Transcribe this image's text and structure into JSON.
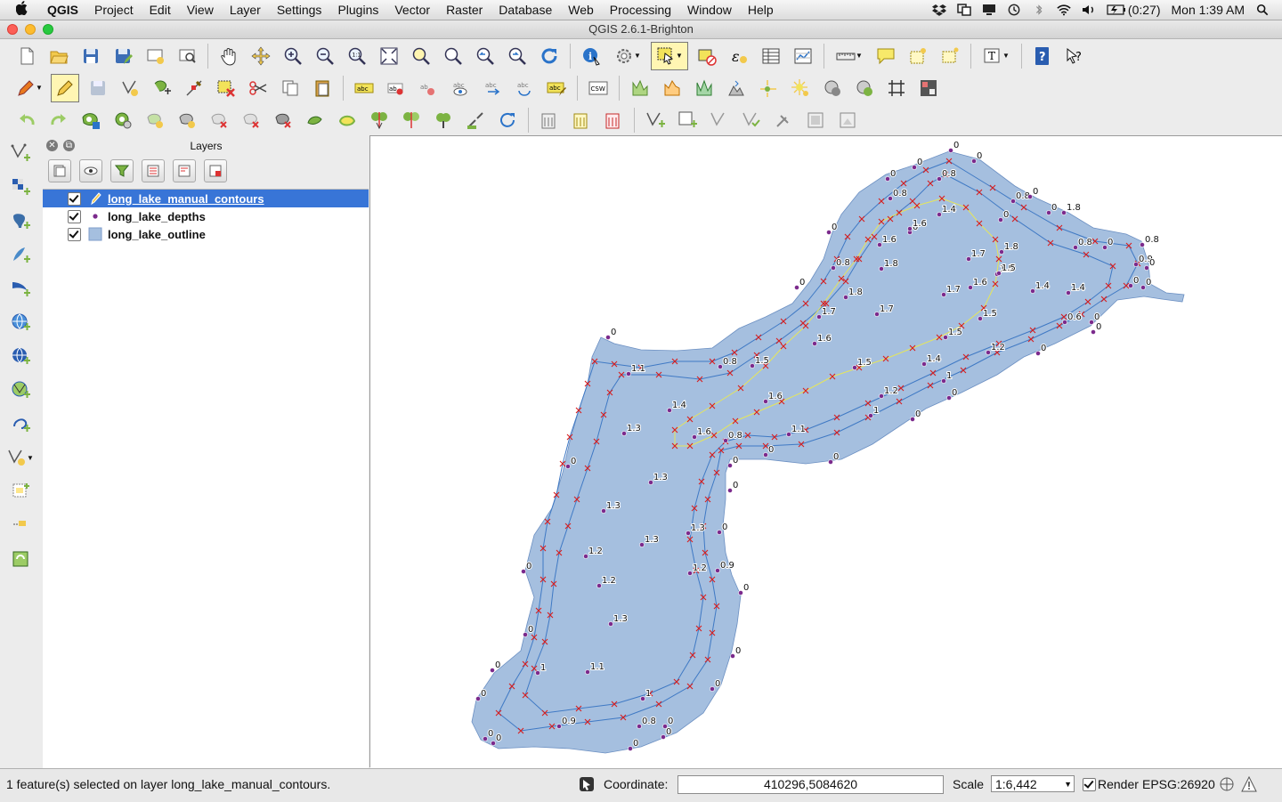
{
  "menubar": {
    "apple": "",
    "app": "QGIS",
    "items": [
      "Project",
      "Edit",
      "View",
      "Layer",
      "Settings",
      "Plugins",
      "Vector",
      "Raster",
      "Database",
      "Web",
      "Processing",
      "Window",
      "Help"
    ],
    "battery": "(0:27)",
    "clock": "Mon 1:39 AM"
  },
  "window": {
    "title": "QGIS 2.6.1-Brighton"
  },
  "layers_panel": {
    "title": "Layers",
    "layers": [
      {
        "name": "long_lake_manual_contours",
        "checked": true,
        "selected": true,
        "symbol": "line-pencil-icon"
      },
      {
        "name": "long_lake_depths",
        "checked": true,
        "selected": false,
        "symbol": "point-icon"
      },
      {
        "name": "long_lake_outline",
        "checked": true,
        "selected": false,
        "symbol": "polygon-fill-icon"
      }
    ]
  },
  "toolbar": {
    "csw_label": "CSW"
  },
  "map": {
    "colors": {
      "lake_fill": "#a5bfdf",
      "lake_stroke": "#5b7db0",
      "contour": "#3f79c4",
      "selected_contour": "#e6e65a",
      "vertex": "#d81d1d",
      "depth_point": "#7b2a8c"
    },
    "depth_labels": [
      {
        "t": "0"
      },
      {
        "t": "0"
      },
      {
        "t": "0"
      },
      {
        "t": "0"
      },
      {
        "t": "0.8"
      },
      {
        "t": "0.8"
      },
      {
        "t": "0.8"
      },
      {
        "t": "0"
      },
      {
        "t": "0"
      },
      {
        "t": "1.8"
      },
      {
        "t": "1.4"
      },
      {
        "t": "0"
      },
      {
        "t": "0"
      },
      {
        "t": "0"
      },
      {
        "t": "1.6"
      },
      {
        "t": "1.6"
      },
      {
        "t": "0.8"
      },
      {
        "t": "0.8"
      },
      {
        "t": "0"
      },
      {
        "t": "0.8"
      },
      {
        "t": "1.8"
      },
      {
        "t": "1.7"
      },
      {
        "t": "1.5"
      },
      {
        "t": "0.9"
      },
      {
        "t": "1.5"
      },
      {
        "t": "0"
      },
      {
        "t": "1.8"
      },
      {
        "t": "1.6"
      },
      {
        "t": "1.7"
      },
      {
        "t": "1.4"
      },
      {
        "t": "1.4"
      },
      {
        "t": "0"
      },
      {
        "t": "0"
      },
      {
        "t": "1.8"
      },
      {
        "t": "1.7"
      },
      {
        "t": "1.7"
      },
      {
        "t": "1.5"
      },
      {
        "t": "0.6"
      },
      {
        "t": "0"
      },
      {
        "t": "0"
      },
      {
        "t": "0"
      },
      {
        "t": "1.6"
      },
      {
        "t": "1.5"
      },
      {
        "t": "1.2"
      },
      {
        "t": "0"
      },
      {
        "t": "0"
      },
      {
        "t": "0.8"
      },
      {
        "t": "1.5"
      },
      {
        "t": "1.5"
      },
      {
        "t": "1.4"
      },
      {
        "t": "1.1"
      },
      {
        "t": "1"
      },
      {
        "t": "1.2"
      },
      {
        "t": "1.6"
      },
      {
        "t": "0"
      },
      {
        "t": "1.4"
      },
      {
        "t": "1"
      },
      {
        "t": "0"
      },
      {
        "t": "1.6"
      },
      {
        "t": "0.8"
      },
      {
        "t": "1.1"
      },
      {
        "t": "1.3"
      },
      {
        "t": "0"
      },
      {
        "t": "0"
      },
      {
        "t": "0"
      },
      {
        "t": "0"
      },
      {
        "t": "1.3"
      },
      {
        "t": "0"
      },
      {
        "t": "1.3"
      },
      {
        "t": "0"
      },
      {
        "t": "1.3"
      },
      {
        "t": "1.3"
      },
      {
        "t": "1.2"
      },
      {
        "t": "0"
      },
      {
        "t": "1.2"
      },
      {
        "t": "0.9"
      },
      {
        "t": "1.2"
      },
      {
        "t": "0"
      },
      {
        "t": "1.3"
      },
      {
        "t": "0"
      },
      {
        "t": "1.1"
      },
      {
        "t": "1"
      },
      {
        "t": "0"
      },
      {
        "t": "0"
      },
      {
        "t": "0"
      },
      {
        "t": "1"
      },
      {
        "t": "0"
      },
      {
        "t": "0.9"
      },
      {
        "t": "0.8"
      },
      {
        "t": "0"
      },
      {
        "t": "0"
      },
      {
        "t": "0"
      },
      {
        "t": "0"
      },
      {
        "t": "0"
      }
    ]
  },
  "statusbar": {
    "message": "1 feature(s) selected on layer long_lake_manual_contours.",
    "coord_label": "Coordinate:",
    "coord_value": "410296,5084620",
    "scale_label": "Scale",
    "scale_value": "1:6,442",
    "render_label": "Render",
    "crs": "EPSG:26920"
  }
}
